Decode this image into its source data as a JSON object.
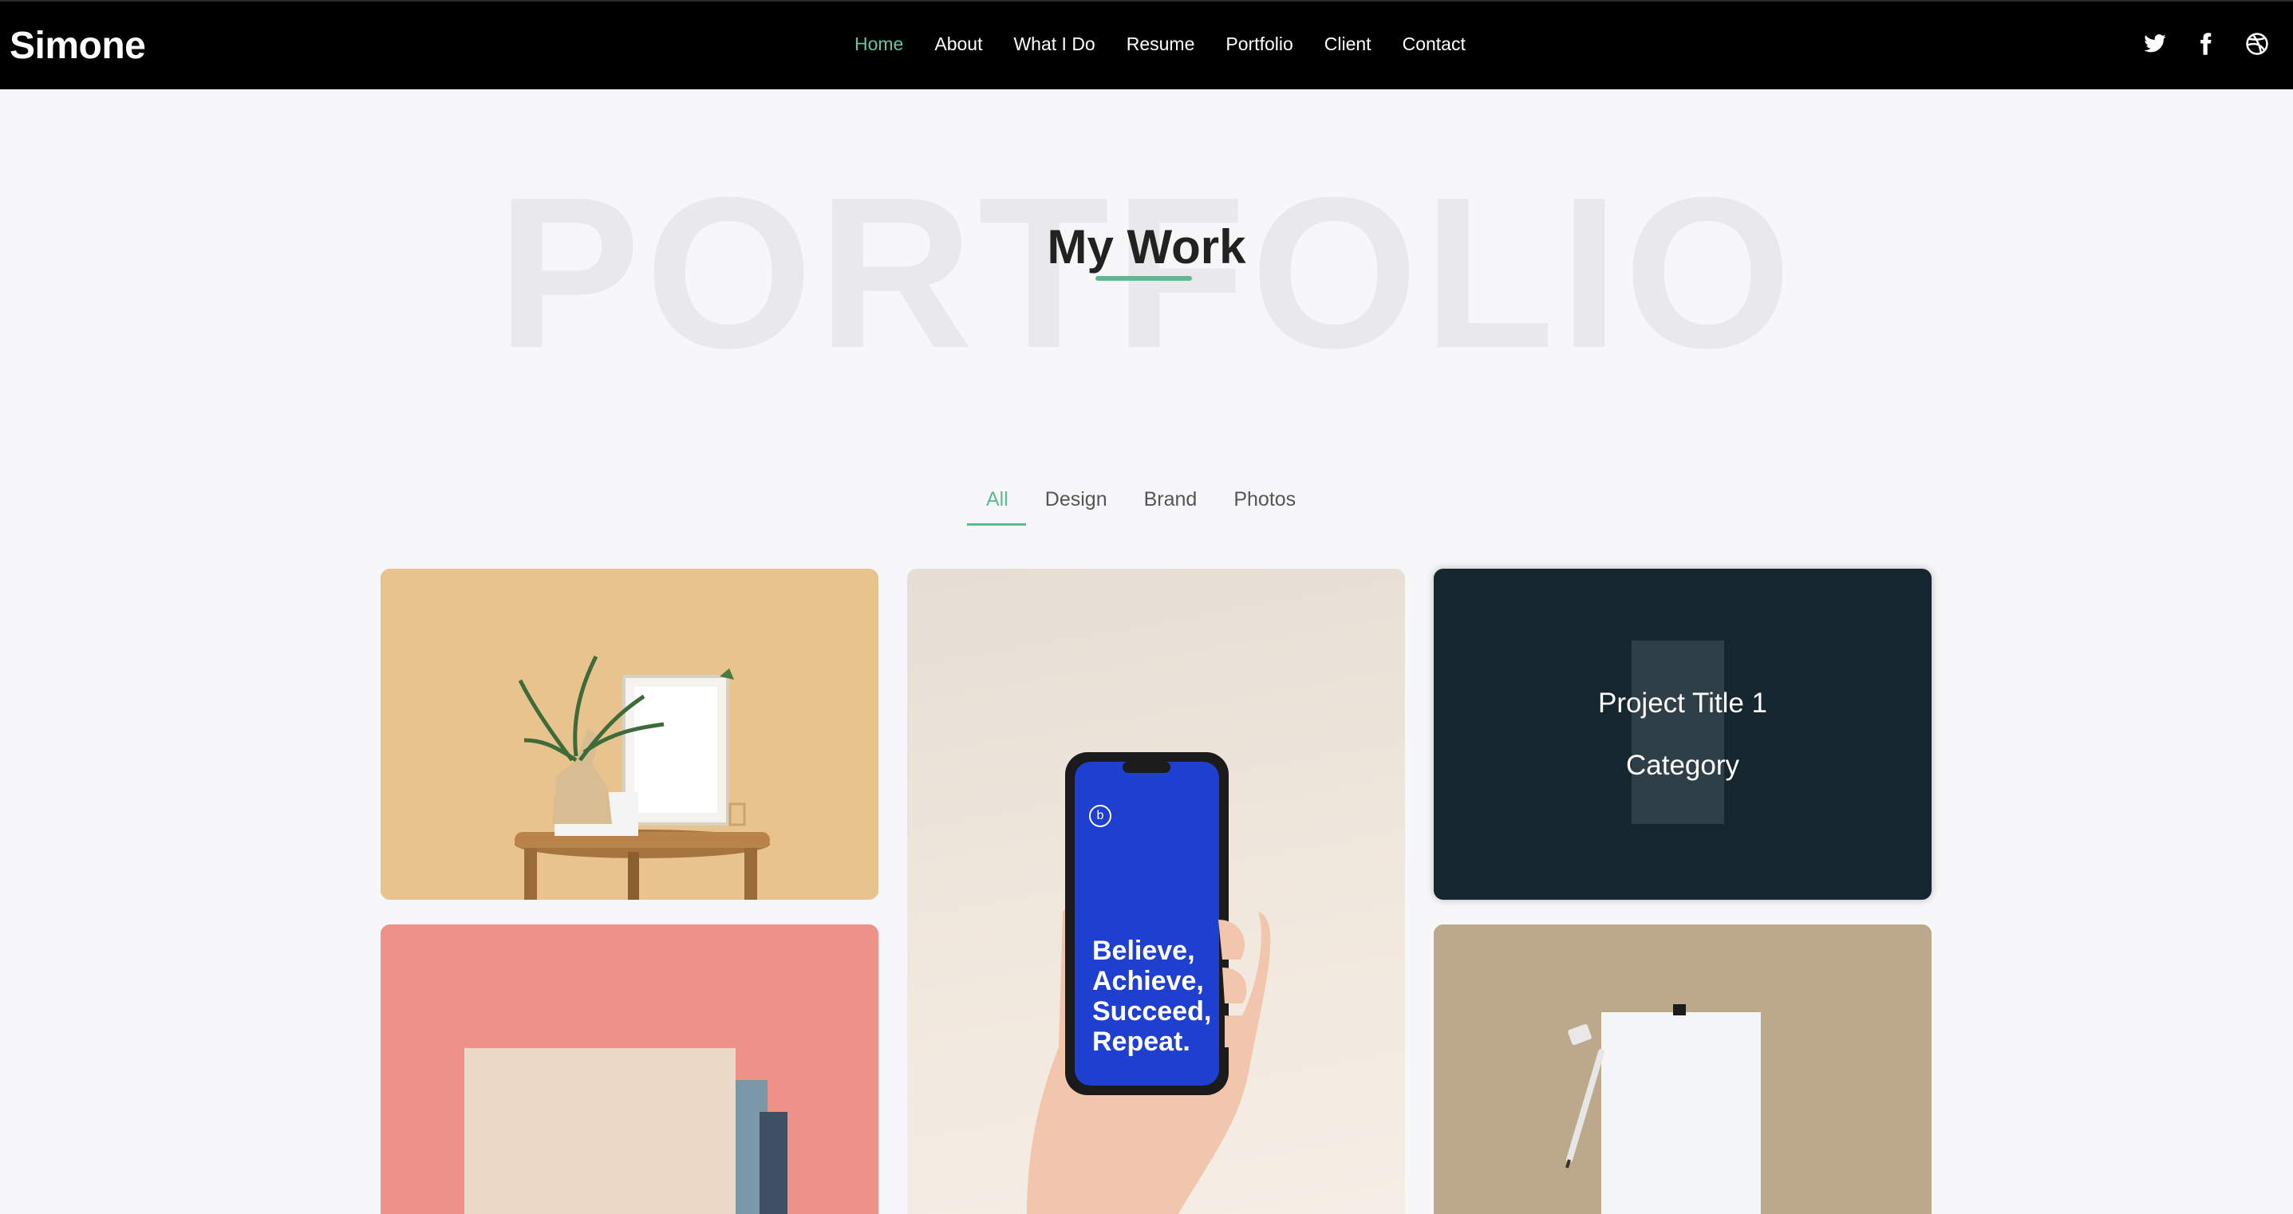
{
  "brand": "Simone",
  "nav": {
    "items": [
      "Home",
      "About",
      "What I Do",
      "Resume",
      "Portfolio",
      "Client",
      "Contact"
    ],
    "active": "Home",
    "active_color": "#5fc8a0"
  },
  "social": [
    "twitter-icon",
    "facebook-icon",
    "dribbble-icon"
  ],
  "hero": {
    "background_text": "PORTFOLIO",
    "title": "My Work",
    "accent_color": "#5fb892"
  },
  "filters": {
    "items": [
      "All",
      "Design",
      "Brand",
      "Photos"
    ],
    "active": "All"
  },
  "portfolio": {
    "hover_card": {
      "title": "Project Title 1",
      "category": "Category"
    },
    "phone_screen_text": [
      "Believe,",
      "Achieve,",
      "Succeed,",
      "Repeat."
    ],
    "phone_logo": "b"
  }
}
